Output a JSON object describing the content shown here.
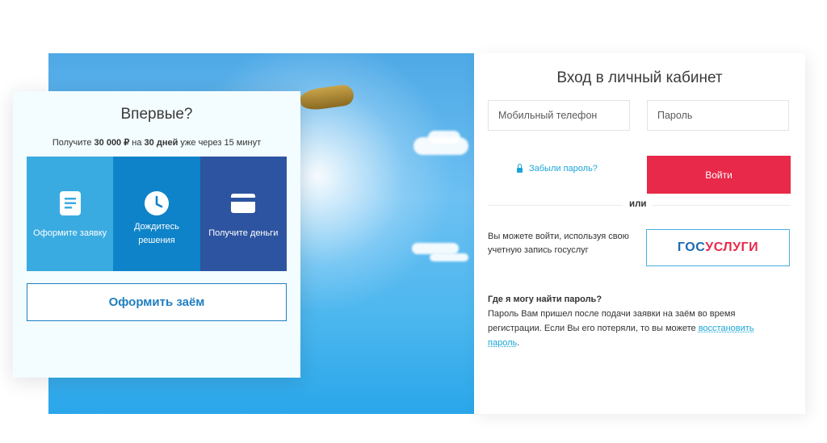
{
  "login": {
    "title": "Вход в личный кабинет",
    "phone_placeholder": "Мобильный телефон",
    "password_placeholder": "Пароль",
    "forgot_label": "Забыли пароль?",
    "login_button": "Войти",
    "or_label": "или",
    "gos_text": "Вы можете войти, используя свою учетную запись госуслуг",
    "gos_logo_part1": "ГОС",
    "gos_logo_part2": "УСЛУГИ",
    "help_question": "Где я могу найти пароль?",
    "help_text": "Пароль Вам пришел после подачи заявки на заём во время регистрации. Если Вы его потеряли, то вы можете ",
    "help_link": "восстановить пароль",
    "help_end": "."
  },
  "card": {
    "title": "Впервые?",
    "sub_prefix": "Получите ",
    "sub_amount": "30 000 ₽",
    "sub_mid": " на ",
    "sub_days": "30 дней",
    "sub_suffix": " уже через 15 минут",
    "steps": [
      {
        "label": "Оформите заявку",
        "icon": "document-icon"
      },
      {
        "label": "Дождитесь решения",
        "icon": "clock-icon"
      },
      {
        "label": "Получите деньги",
        "icon": "card-icon"
      }
    ],
    "apply_button": "Оформить заём"
  },
  "colors": {
    "accent_red": "#e8294a",
    "link_blue": "#1aa6d6",
    "step1": "#3aabe0",
    "step2": "#0f83c9",
    "step3": "#2d54a0"
  }
}
